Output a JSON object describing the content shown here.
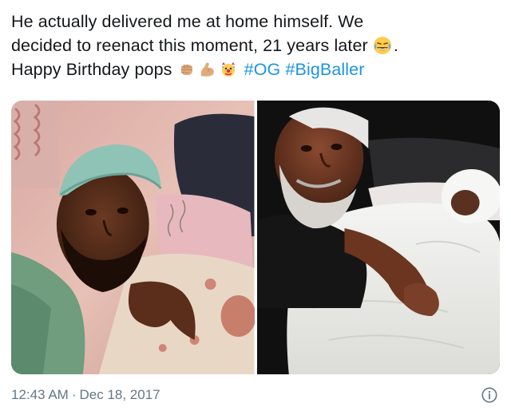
{
  "tweet": {
    "line1": "He actually delivered me at home himself. We",
    "line2_text": "decided to reenact this moment, 21 years later",
    "line2_end": ".",
    "line3_text": "Happy Birthday pops",
    "hashtags": [
      "#OG",
      "#BigBaller"
    ],
    "emojis": [
      "laughing-tears-emoji",
      "fist-medium-skin-emoji",
      "flexed-bicep-emoji",
      "clown-sparkle-emoji"
    ]
  },
  "photos": [
    {
      "name": "photo-1997-delivery",
      "description_icon": "photo"
    },
    {
      "name": "photo-reenactment",
      "description_icon": "photo"
    }
  ],
  "meta": {
    "time": "12:43 AM",
    "separator": "·",
    "date": "Dec 18, 2017",
    "info_icon": "info-circle-icon"
  },
  "colors": {
    "text": "#14171a",
    "hashtag": "#1b95e0",
    "meta": "#657786"
  }
}
